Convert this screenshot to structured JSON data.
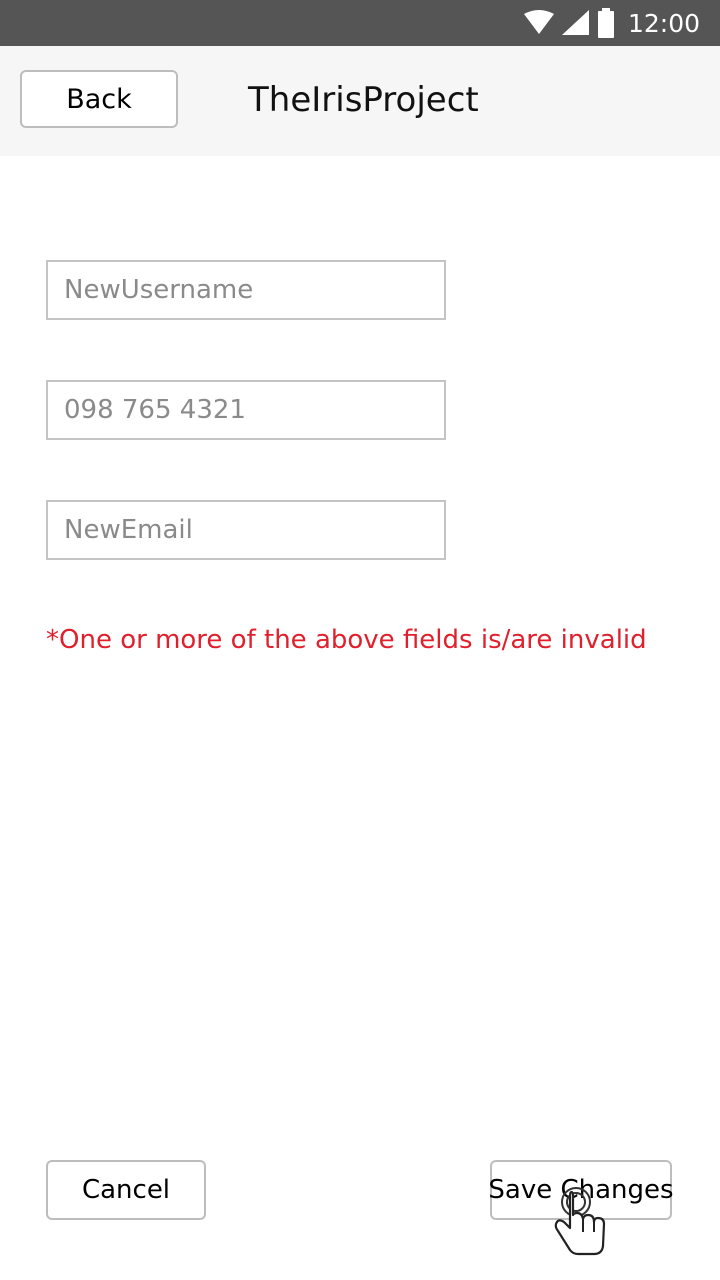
{
  "status_bar": {
    "time": "12:00",
    "icons": [
      "wifi-icon",
      "signal-icon",
      "battery-icon"
    ]
  },
  "header": {
    "back_label": "Back",
    "title": "TheIrisProject"
  },
  "form": {
    "username_placeholder": "NewUsername",
    "phone_placeholder": "098 765 4321",
    "email_placeholder": "NewEmail",
    "error_message": "*One or more of the above fields is/are invalid"
  },
  "actions": {
    "cancel_label": "Cancel",
    "save_label": "Save Changes"
  },
  "colors": {
    "status_bar": "#555555",
    "app_bar": "#f6f6f6",
    "error": "#e0202c",
    "border": "#bdbdbd"
  }
}
